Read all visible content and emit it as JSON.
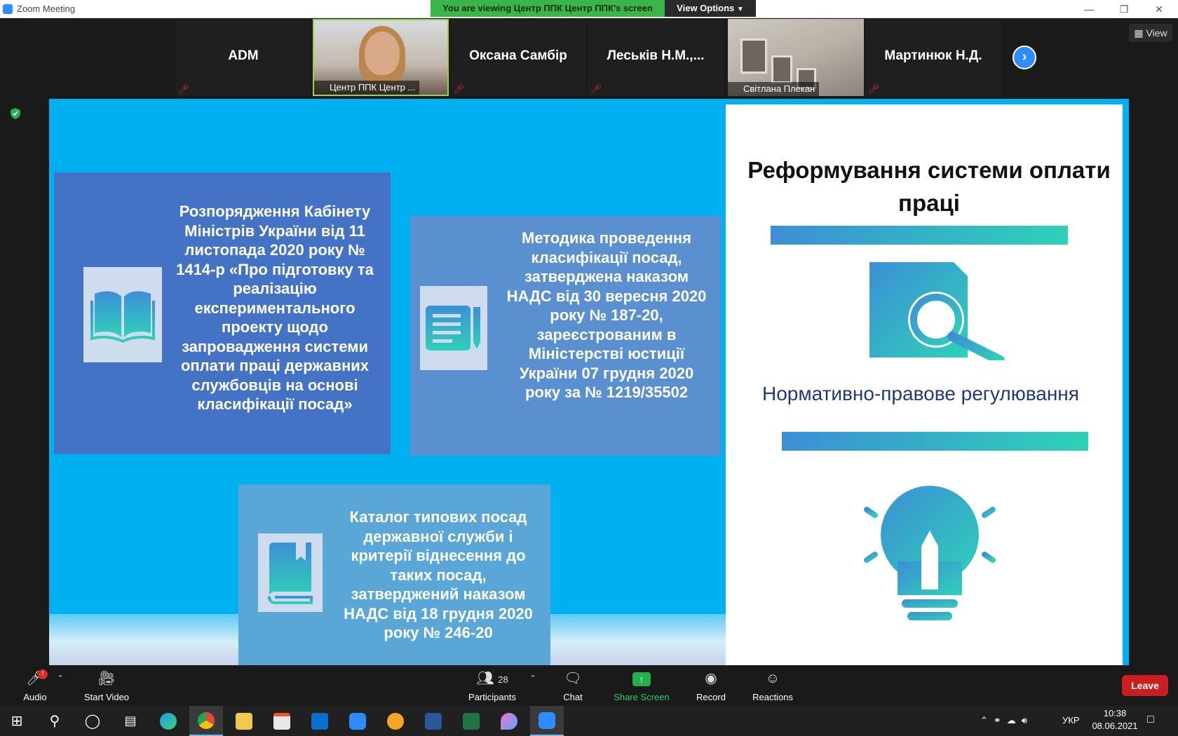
{
  "window": {
    "title": "Zoom Meeting",
    "viewing_banner": "You are viewing Центр ППК Центр ППК's screen",
    "view_options": "View Options",
    "view_button": "View",
    "minimize": "—",
    "restore": "❐",
    "close": "✕"
  },
  "gallery": {
    "tiles": [
      {
        "name": "ADM",
        "caption": ""
      },
      {
        "name": "",
        "caption": "Центр ППК Центр ..."
      },
      {
        "name": "Оксана Самбір",
        "caption": ""
      },
      {
        "name": "Леськів Н.М.,...",
        "caption": ""
      },
      {
        "name": "",
        "caption": "Світлана Плекан"
      },
      {
        "name": "Мартинюк Н.Д.",
        "caption": ""
      }
    ],
    "next_icon": "chevron-right-icon"
  },
  "slide": {
    "box1_text": "Розпорядження Кабінету Міністрів України від 11 листопада 2020 року № 1414-р «Про підготовку та реалізацію експериментального проекту щодо запровадження системи оплати праці державних службовців на основі класифікації посад»",
    "box2_text": "Методика проведення класифікації посад, затверджена наказом НАДС від 30 вересня 2020 року № 187-20, зареєстрованим в Міністерстві юстиції України 07 грудня 2020 року за № 1219/35502",
    "box3_text": "Каталог типових посад державної служби і критерії віднесення до таких посад, затверджений наказом НАДС від 18 грудня 2020 року № 246-20",
    "right_title": "Реформування системи оплати праці",
    "right_subtitle": "Нормативно-правове регулювання",
    "colors": {
      "background": "#00b0f0",
      "box1": "#4472c4",
      "box2": "#5a8fd0",
      "box3": "#5aa6d6"
    }
  },
  "toolbar": {
    "audio": "Audio",
    "audio_badge": "!",
    "start_video": "Start Video",
    "participants": "Participants",
    "participants_count": "28",
    "chat": "Chat",
    "share_screen": "Share Screen",
    "record": "Record",
    "reactions": "Reactions",
    "leave": "Leave"
  },
  "taskbar": {
    "language": "УКР",
    "time": "10:38",
    "date": "08.06.2021"
  }
}
